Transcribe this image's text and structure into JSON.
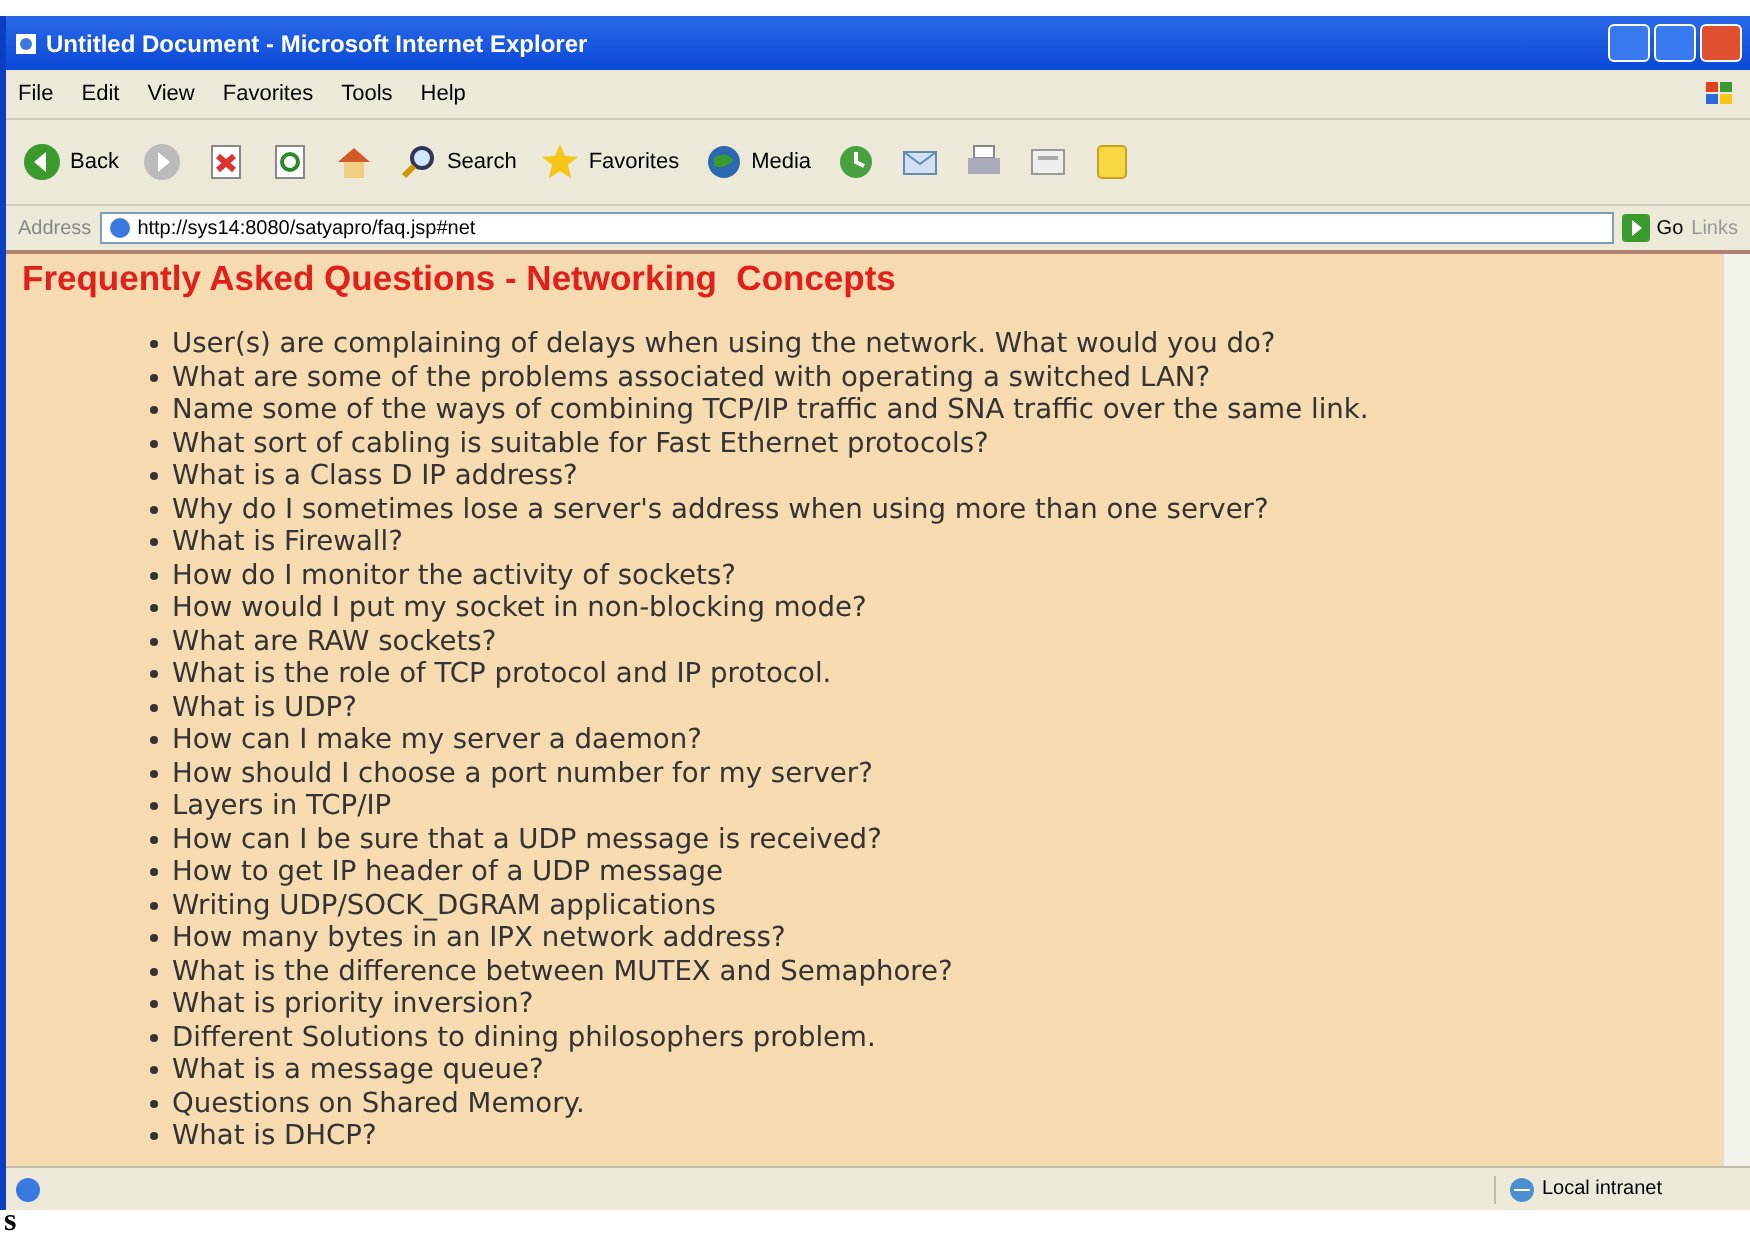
{
  "window": {
    "title": "Untitled Document - Microsoft Internet Explorer"
  },
  "menu": [
    "File",
    "Edit",
    "View",
    "Favorites",
    "Tools",
    "Help"
  ],
  "toolbar": [
    {
      "kind": "back",
      "label": "Back"
    },
    {
      "kind": "forward"
    },
    {
      "kind": "stop"
    },
    {
      "kind": "refresh"
    },
    {
      "kind": "home"
    },
    {
      "kind": "search",
      "label": "Search"
    },
    {
      "kind": "favorites",
      "label": "Favorites"
    },
    {
      "kind": "media",
      "label": "Media"
    },
    {
      "kind": "history"
    },
    {
      "kind": "mail"
    },
    {
      "kind": "print"
    },
    {
      "kind": "edit"
    },
    {
      "kind": "notes"
    }
  ],
  "address_bar": {
    "label": "Address",
    "value": "http://sys14:8080/satyapro/faq.jsp#net",
    "go": "Go",
    "links": "Links"
  },
  "page": {
    "heading": "Frequently Asked Questions - Networking  Concepts",
    "questions": [
      "User(s) are complaining of delays when using the network. What would you do?",
      "What are some of the problems associated with operating a switched LAN?",
      "Name some of the ways of combining TCP/IP traffic and SNA traffic over the same link.",
      "What sort of cabling is suitable for Fast Ethernet protocols?",
      "What is a Class D IP address?",
      "Why do I sometimes lose a server's address when using more than one server?",
      "What is Firewall?",
      "How do I monitor the activity of sockets?",
      "How would I put my socket in non-blocking mode?",
      "What are RAW sockets?",
      "What is the role of TCP protocol and IP protocol.",
      "What is UDP?",
      "How can I make my server a daemon?",
      "How should I choose a port number for my server?",
      "Layers in TCP/IP",
      "How can I be sure that a UDP message is received?",
      "How to get IP header of a UDP message",
      "Writing UDP/SOCK_DGRAM applications",
      "How many bytes in an IPX network address?",
      "What is the difference between MUTEX and Semaphore?",
      "What is priority inversion?",
      "Different Solutions to dining philosophers problem.",
      "What is a message queue?",
      "Questions on Shared Memory.",
      "What is DHCP?"
    ]
  },
  "status_bar": {
    "zone": "Local intranet"
  },
  "stray_text": "s"
}
